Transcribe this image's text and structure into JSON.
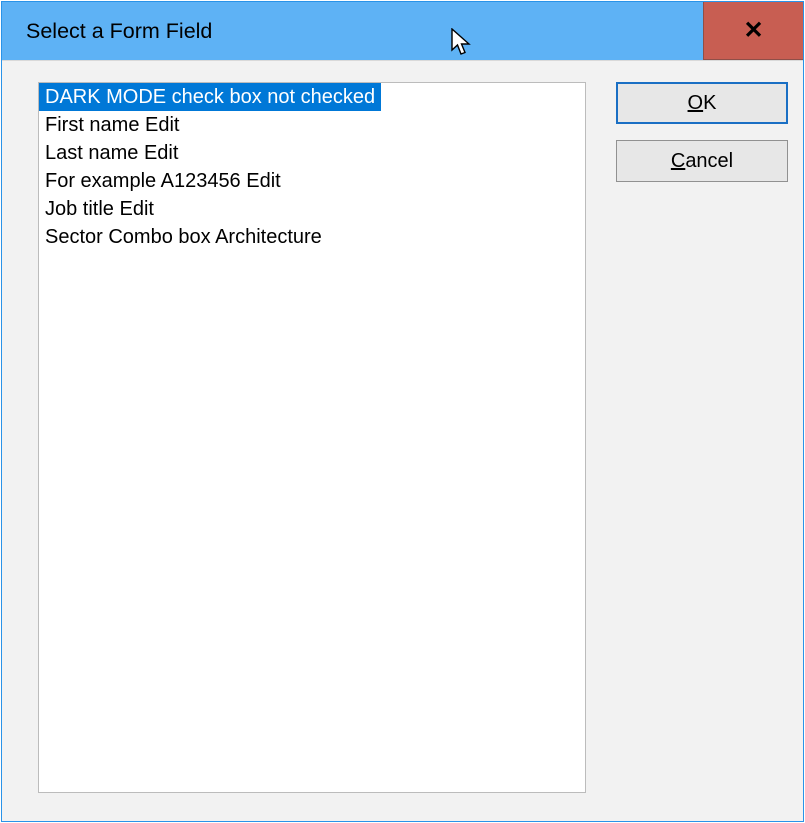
{
  "window": {
    "title": "Select a Form Field"
  },
  "icons": {
    "close": "✕"
  },
  "list": {
    "items": [
      "DARK MODE check box   not checked",
      "First name Edit",
      "Last name Edit",
      "For example A123456 Edit",
      "Job title Edit",
      "Sector Combo box Architecture"
    ],
    "selected_index": 0
  },
  "buttons": {
    "ok": {
      "pre": "",
      "mnemonic": "O",
      "post": "K"
    },
    "cancel": {
      "pre": "",
      "mnemonic": "C",
      "post": "ancel"
    }
  }
}
